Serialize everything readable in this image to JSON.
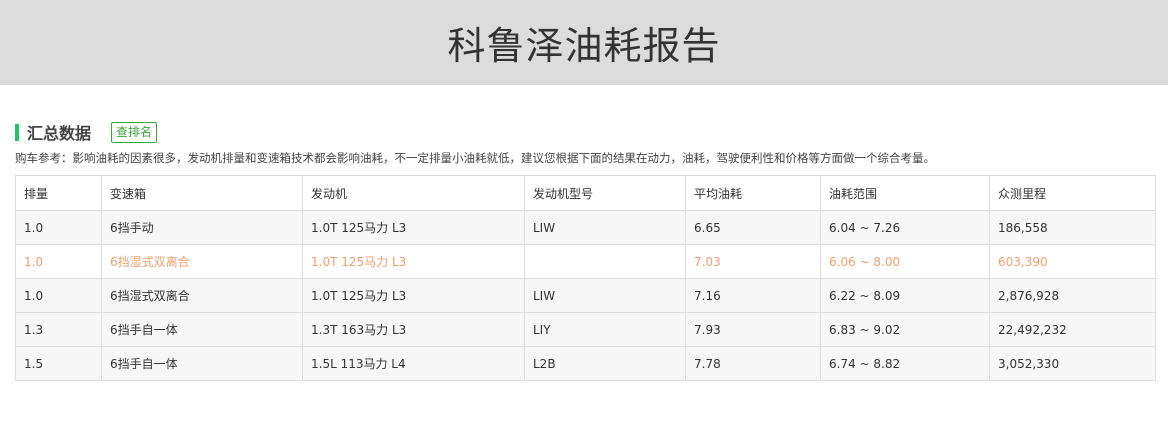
{
  "page": {
    "title": "科鲁泽油耗报告"
  },
  "summary": {
    "title": "汇总数据",
    "rank_button": "查排名",
    "note": "购车参考：影响油耗的因素很多，发动机排量和变速箱技术都会影响油耗，不一定排量小油耗就低，建议您根据下面的结果在动力，油耗，驾驶便利性和价格等方面做一个综合考量。"
  },
  "table": {
    "headers": [
      "排量",
      "变速箱",
      "发动机",
      "发动机型号",
      "平均油耗",
      "油耗范围",
      "众测里程"
    ],
    "rows": [
      [
        "1.0",
        "6挡手动",
        "1.0T 125马力 L3",
        "LIW",
        "6.65",
        "6.04 ~ 7.26",
        "186,558"
      ],
      [
        "1.0",
        "6挡湿式双离合",
        "1.0T 125马力 L3",
        "",
        "7.03",
        "6.06 ~ 8.00",
        "603,390"
      ],
      [
        "1.0",
        "6挡湿式双离合",
        "1.0T 125马力 L3",
        "LIW",
        "7.16",
        "6.22 ~ 8.09",
        "2,876,928"
      ],
      [
        "1.3",
        "6挡手自一体",
        "1.3T 163马力 L3",
        "LIY",
        "7.93",
        "6.83 ~ 9.02",
        "22,492,232"
      ],
      [
        "1.5",
        "6挡手自一体",
        "1.5L 113马力 L4",
        "L2B",
        "7.78",
        "6.74 ~ 8.82",
        "3,052,330"
      ]
    ],
    "highlight_row_color": "#f0a070",
    "accent_color": "#22c36b"
  }
}
